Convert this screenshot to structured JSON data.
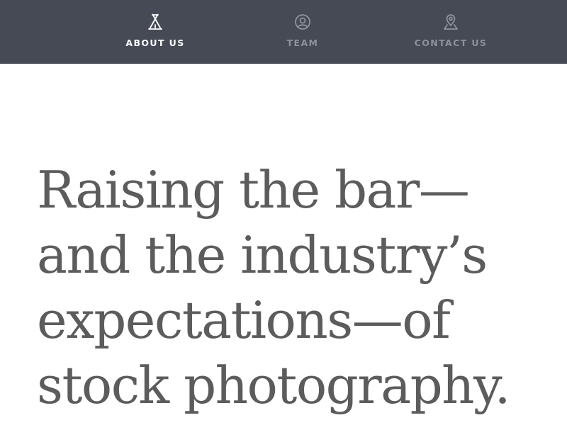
{
  "nav": {
    "items": [
      {
        "label": "ABOUT US",
        "icon": "tent-icon",
        "active": true
      },
      {
        "label": "TEAM",
        "icon": "user-circle-icon",
        "active": false
      },
      {
        "label": "CONTACT US",
        "icon": "map-pin-icon",
        "active": false
      }
    ]
  },
  "hero": {
    "heading": "Raising the bar—and the industry’s expectations—of stock photography."
  },
  "colors": {
    "nav_background": "#454a55",
    "nav_active_text": "#ffffff",
    "nav_inactive_text": "#8d929b",
    "heading_text": "#5c5c5c",
    "page_background": "#ffffff"
  }
}
